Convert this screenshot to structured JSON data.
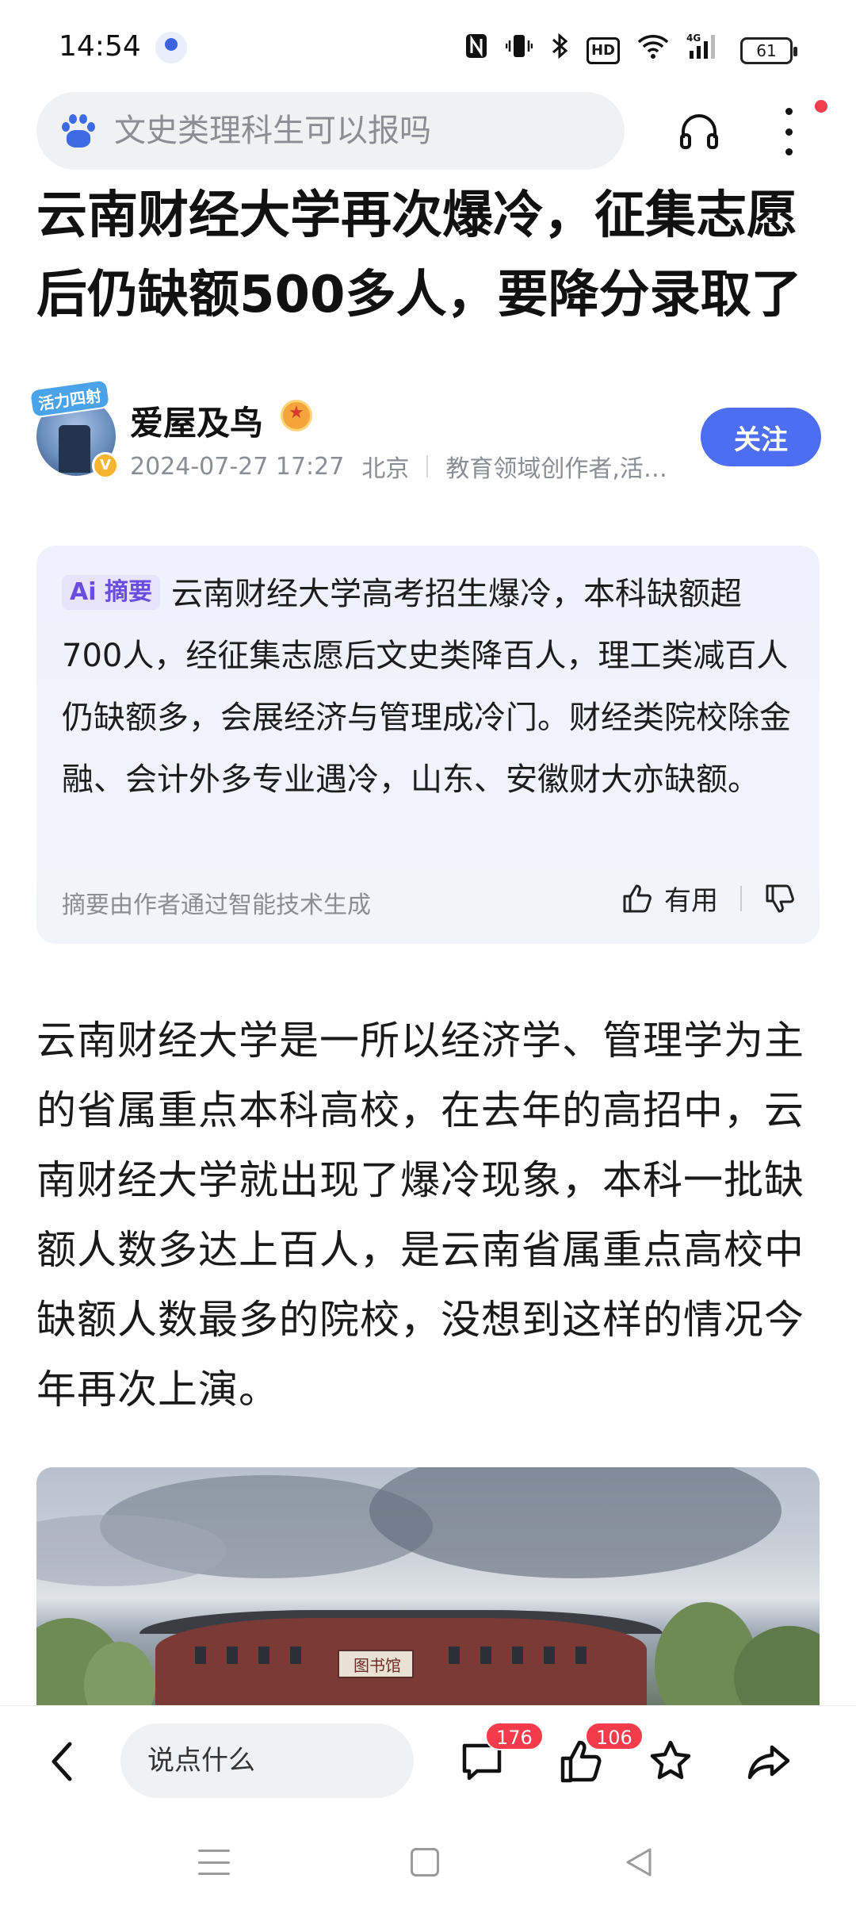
{
  "status_bar": {
    "time": "14:54",
    "battery": "61",
    "network": "4G",
    "hd_label": "HD",
    "icons": [
      "nfc-icon",
      "vibrate-icon",
      "bluetooth-icon",
      "hd-icon",
      "wifi-icon",
      "signal-icon",
      "battery-icon"
    ]
  },
  "search": {
    "placeholder": "文史类理科生可以报吗"
  },
  "article": {
    "title": "云南财经大学再次爆冷，征集志愿后仍缺额500多人，要降分录取了",
    "author": {
      "avatar_tag": "活力四射",
      "name": "爱屋及鸟",
      "datetime": "2024-07-27 17:27",
      "location": "北京",
      "description": "教育领域创作者,活…",
      "follow_label": "关注"
    },
    "summary": {
      "badge": "Ai 摘要",
      "text": "云南财经大学高考招生爆冷，本科缺额超700人，经征集志愿后文史类降百人，理工类减百人仍缺额多，会展经济与管理成冷门。财经类院校除金融、会计外多专业遇冷，山东、安徽财大亦缺额。",
      "footer": "摘要由作者通过智能技术生成",
      "useful_label": "有用"
    },
    "body": "云南财经大学是一所以经济学、管理学为主的省属重点本科高校，在去年的高招中，云南财经大学就出现了爆冷现象，本科一批缺额人数多达上百人，是云南省属重点高校中缺额人数最多的院校，没想到这样的情况今年再次上演。",
    "photo_sign": "图书馆"
  },
  "action_bar": {
    "comment_placeholder": "说点什么",
    "comment_count": "176",
    "like_count": "106"
  },
  "colors": {
    "accent": "#4e6ef2",
    "badge_red": "#f43b4c",
    "summary_bg": "#f1f0fd"
  }
}
